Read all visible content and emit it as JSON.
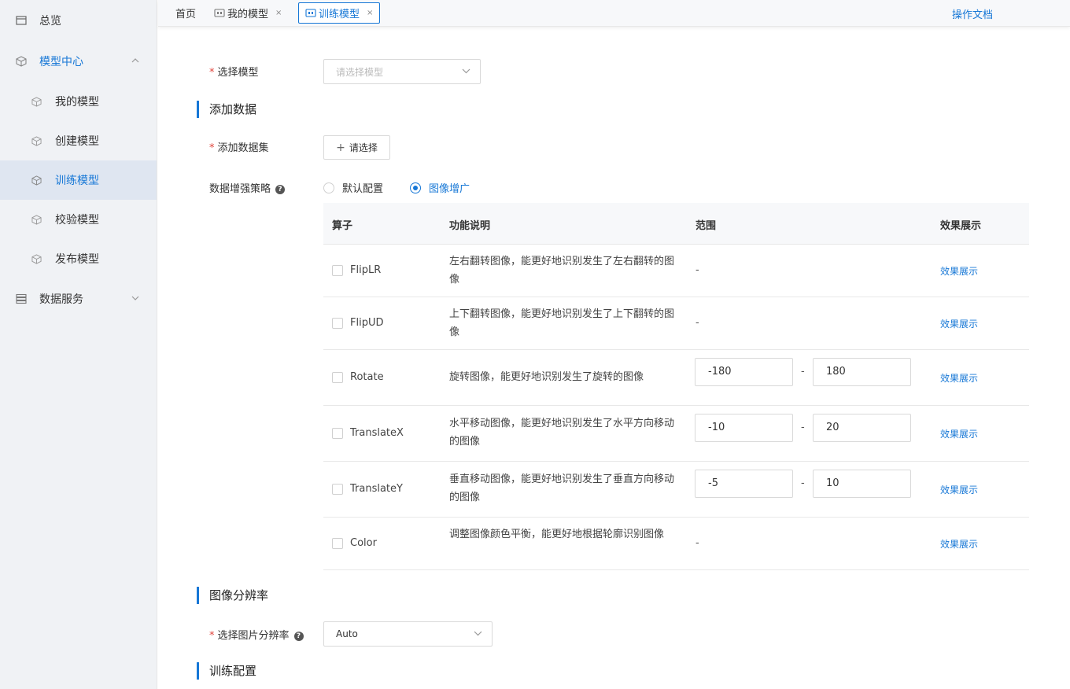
{
  "sidebar": {
    "overview": "总览",
    "model_center": "模型中心",
    "items": [
      {
        "label": "我的模型"
      },
      {
        "label": "创建模型"
      },
      {
        "label": "训练模型"
      },
      {
        "label": "校验模型"
      },
      {
        "label": "发布模型"
      }
    ],
    "data_service": "数据服务"
  },
  "topbar": {
    "tabs": [
      {
        "label": "首页"
      },
      {
        "label": "我的模型",
        "close": "×"
      },
      {
        "label": "训练模型",
        "close": "×"
      }
    ],
    "docs_link": "操作文档"
  },
  "form": {
    "select_model_label": "选择模型",
    "select_model_placeholder": "请选择模型",
    "section_add_data": "添加数据",
    "add_dataset_label": "添加数据集",
    "add_dataset_button": "请选择",
    "augment_label": "数据增强策略",
    "augment_options": [
      "默认配置",
      "图像增广"
    ],
    "augment_selected": "图像增广",
    "section_resolution": "图像分辨率",
    "resolution_label": "选择图片分辨率",
    "resolution_value": "Auto",
    "section_train_config": "训练配置"
  },
  "table": {
    "headers": [
      "算子",
      "功能说明",
      "范围",
      "效果展示"
    ],
    "rows": [
      {
        "op": "FlipLR",
        "desc": "左右翻转图像，能更好地识别发生了左右翻转的图像",
        "range": "-",
        "effect": "效果展示"
      },
      {
        "op": "FlipUD",
        "desc": "上下翻转图像，能更好地识别发生了上下翻转的图像",
        "range": "-",
        "effect": "效果展示"
      },
      {
        "op": "Rotate",
        "desc": "旋转图像，能更好地识别发生了旋转的图像",
        "min": "-180",
        "max": "180",
        "sep": "-",
        "effect": "效果展示"
      },
      {
        "op": "TranslateX",
        "desc": "水平移动图像，能更好地识别发生了水平方向移动的图像",
        "min": "-10",
        "max": "20",
        "sep": "-",
        "effect": "效果展示"
      },
      {
        "op": "TranslateY",
        "desc": "垂直移动图像，能更好地识别发生了垂直方向移动的图像",
        "min": "-5",
        "max": "10",
        "sep": "-",
        "effect": "效果展示"
      },
      {
        "op": "Color",
        "desc": "调整图像颜色平衡，能更好地根据轮廓识别图像",
        "range": "-",
        "effect": "效果展示"
      }
    ]
  },
  "colors": {
    "accent": "#1677d6",
    "required": "#e0443c",
    "sidebar_bg": "#f0f2f5",
    "active_bg": "#dfe6f1"
  }
}
